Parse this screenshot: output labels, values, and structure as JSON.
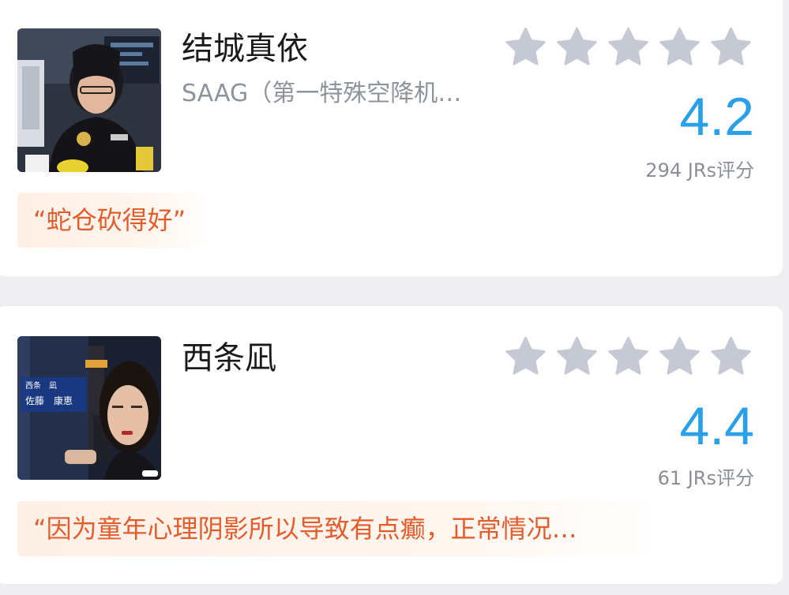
{
  "entries": [
    {
      "name": "结城真依",
      "subtitle": "SAAG（第一特殊空降机…",
      "score": "4.2",
      "count": "294 JRs评分",
      "quote": "“蛇仓砍得好”",
      "stars_total": 5,
      "stars_filled": 0,
      "thumb_icon": "character-photo"
    },
    {
      "name": "西条凪",
      "subtitle": "",
      "score": "4.4",
      "count": "61 JRs评分",
      "quote": "“因为童年心理阴影所以导致有点癫，正常情况…",
      "stars_total": 5,
      "stars_filled": 0,
      "thumb_icon": "character-photo",
      "thumb_caption_line1": "西条　凪",
      "thumb_caption_line2": "佐藤　康恵"
    }
  ],
  "colors": {
    "score": "#2aa0e8",
    "quote_text": "#e35d2c",
    "quote_bg": "#fff0e6",
    "star_empty": "#c5c9d3",
    "name": "#1a1a1a",
    "muted": "#8a8f96"
  }
}
